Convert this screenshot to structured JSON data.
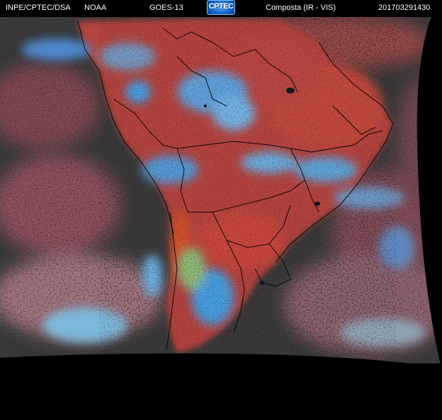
{
  "header": {
    "source": "INPE/CPTEC/DSA",
    "agency": "NOAA",
    "satellite": "GOES-13",
    "product": "Composta (IR - VIS)",
    "timestamp": "201703291430"
  },
  "logo": {
    "text": "CPTEC"
  },
  "colors": {
    "background": "#000000",
    "land_red": "#b5453f",
    "cloud_blue": "#4fa8e6",
    "cloud_cyan": "#6fd0e8",
    "ocean_dark": "#3a3a3a",
    "cloud_pink": "#c87f8f",
    "cloud_green": "#9ab57a",
    "border_lines": "#000000"
  }
}
